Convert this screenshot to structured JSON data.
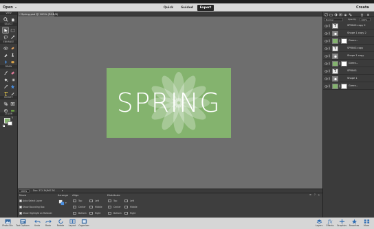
{
  "menu": {
    "open_label": "Open",
    "modes": [
      "Quick",
      "Guided",
      "Expert"
    ],
    "active_mode": "Expert",
    "create_label": "Create"
  },
  "toolbar": {
    "sections": [
      "VIEW",
      "SELECT",
      "ENHANCE",
      "DRAW",
      "MODIFY",
      "COLOR"
    ]
  },
  "document": {
    "tab_title": "Spring.psd @ 100% (RGB/8)",
    "zoom": "100%",
    "info": "Doc: 372.3K/867.5K"
  },
  "artwork": {
    "text": "SPRING",
    "bg_color": "#84b36e"
  },
  "tool_options": {
    "move_title": "Move",
    "auto_select": "Auto Select Layer",
    "bounding_box": "Show Bounding Box",
    "highlight": "Show Highlight on Rollover",
    "arrange_title": "Arrange",
    "align_title": "Align",
    "align_left_col": [
      "Top",
      "Center",
      "Bottom"
    ],
    "align_right_col": [
      "Left",
      "Middle",
      "Right"
    ],
    "distribute_title": "Distribute",
    "distribute_left_col": [
      "Top",
      "Center",
      "Bottom"
    ],
    "distribute_right_col": [
      "Left",
      "Middle",
      "Right"
    ]
  },
  "layers_panel": {
    "blend_mode": "Normal",
    "opacity_label": "Opacity:",
    "opacity_value": "100%",
    "layers": [
      {
        "name": "SPRING copy 2",
        "kind": "text"
      },
      {
        "name": "Shape 1 copy 2",
        "kind": "shape"
      },
      {
        "name": "Green...",
        "kind": "fill"
      },
      {
        "name": "SPRING copy",
        "kind": "text"
      },
      {
        "name": "Shape 1 copy",
        "kind": "shape"
      },
      {
        "name": "Green...",
        "kind": "fill"
      },
      {
        "name": "SPRING",
        "kind": "text"
      },
      {
        "name": "Shape 1",
        "kind": "shape"
      },
      {
        "name": "Green...",
        "kind": "fill"
      }
    ]
  },
  "bottom_bar": {
    "left": [
      "Photo Bin",
      "Tool Options",
      "Undo",
      "Redo",
      "Rotate",
      "Layout",
      "Organizer"
    ],
    "right": [
      "Layers",
      "Effects",
      "Graphics",
      "Favorites",
      "More"
    ]
  },
  "colors": {
    "panel_bg": "#3b3b3b",
    "canvas_bg": "#6e6e6e",
    "accent_green": "#84b36e",
    "active_mode_bg": "#262626"
  }
}
